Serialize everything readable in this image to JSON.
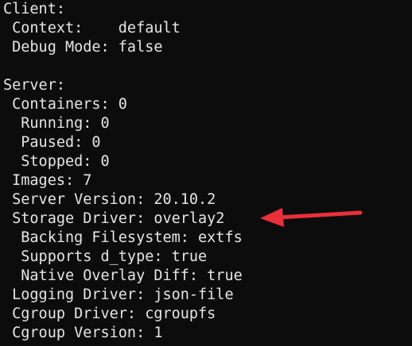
{
  "terminal": {
    "lines": [
      "Client:",
      " Context:    default",
      " Debug Mode: false",
      "",
      "Server:",
      " Containers: 0",
      "  Running: 0",
      "  Paused: 0",
      "  Stopped: 0",
      " Images: 7",
      " Server Version: 20.10.2",
      " Storage Driver: overlay2",
      "  Backing Filesystem: extfs",
      "  Supports d_type: true",
      "  Native Overlay Diff: true",
      " Logging Driver: json-file",
      " Cgroup Driver: cgroupfs",
      " Cgroup Version: 1"
    ]
  },
  "annotation": {
    "icon": "arrow-left-icon",
    "color": "#e8303a"
  }
}
